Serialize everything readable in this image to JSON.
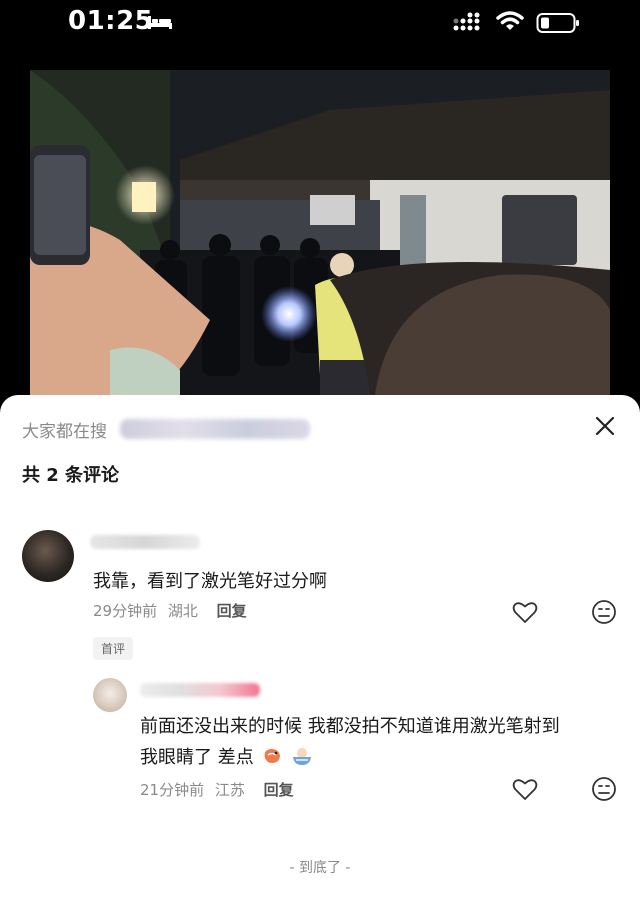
{
  "status_bar": {
    "time": "01:25"
  },
  "sheet": {
    "search_hint": "大家都在搜",
    "comment_count": "共 2 条评论",
    "comments": [
      {
        "text": "我靠，看到了激光笔好过分啊",
        "time": "29分钟前",
        "location": "湖北",
        "reply_label": "回复",
        "badge": "首评"
      }
    ],
    "replies": [
      {
        "text_line1": "前面还没出来的时候 我都没拍不知道谁用激光笔射到",
        "text_line2": "我眼睛了 差点",
        "time": "21分钟前",
        "location": "江苏",
        "reply_label": "回复"
      }
    ],
    "end_text": "- 到底了 -"
  },
  "icons": [
    "bed-icon",
    "signal-icon",
    "wifi-icon",
    "battery-icon",
    "close-icon",
    "like-icon",
    "emoji-icon"
  ]
}
